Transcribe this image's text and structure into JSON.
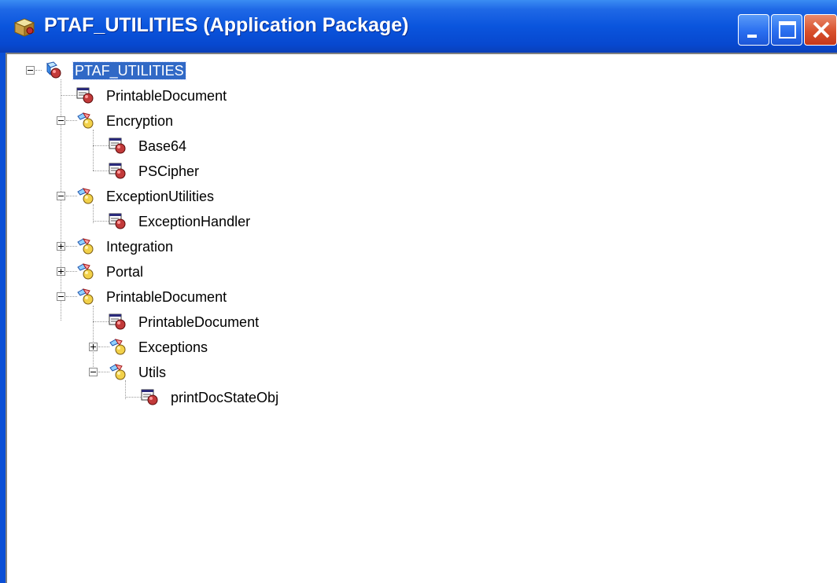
{
  "window": {
    "title": "PTAF_UTILITIES (Application Package)",
    "title_icon": "application-package-icon",
    "buttons": {
      "minimize": "minimize-icon",
      "maximize": "maximize-icon",
      "close": "close-icon"
    }
  },
  "colors": {
    "titlebar": "#0a55dd",
    "selection": "#3169c6",
    "close_button": "#d8502c"
  },
  "tree": {
    "root": {
      "label": "PTAF_UTILITIES",
      "expanded": true,
      "selected": true,
      "icon": "package-root-icon"
    },
    "items": [
      {
        "label": "PrintableDocument",
        "type": "class",
        "icon": "class-icon"
      },
      {
        "label": "Encryption",
        "type": "package",
        "expanded": true,
        "icon": "package-icon"
      },
      {
        "label": "Base64",
        "type": "class",
        "icon": "class-icon"
      },
      {
        "label": "PSCipher",
        "type": "class",
        "icon": "class-icon"
      },
      {
        "label": "ExceptionUtilities",
        "type": "package",
        "expanded": true,
        "icon": "package-icon"
      },
      {
        "label": "ExceptionHandler",
        "type": "class",
        "icon": "class-icon"
      },
      {
        "label": "Integration",
        "type": "package",
        "expanded": false,
        "icon": "package-icon"
      },
      {
        "label": "Portal",
        "type": "package",
        "expanded": false,
        "icon": "package-icon"
      },
      {
        "label": "PrintableDocument",
        "type": "package",
        "expanded": true,
        "icon": "package-icon"
      },
      {
        "label": "PrintableDocument",
        "type": "class",
        "icon": "class-icon"
      },
      {
        "label": "Exceptions",
        "type": "package",
        "expanded": false,
        "icon": "package-icon"
      },
      {
        "label": "Utils",
        "type": "package",
        "expanded": true,
        "icon": "package-icon"
      },
      {
        "label": "printDocStateObj",
        "type": "class",
        "icon": "class-icon"
      }
    ]
  }
}
